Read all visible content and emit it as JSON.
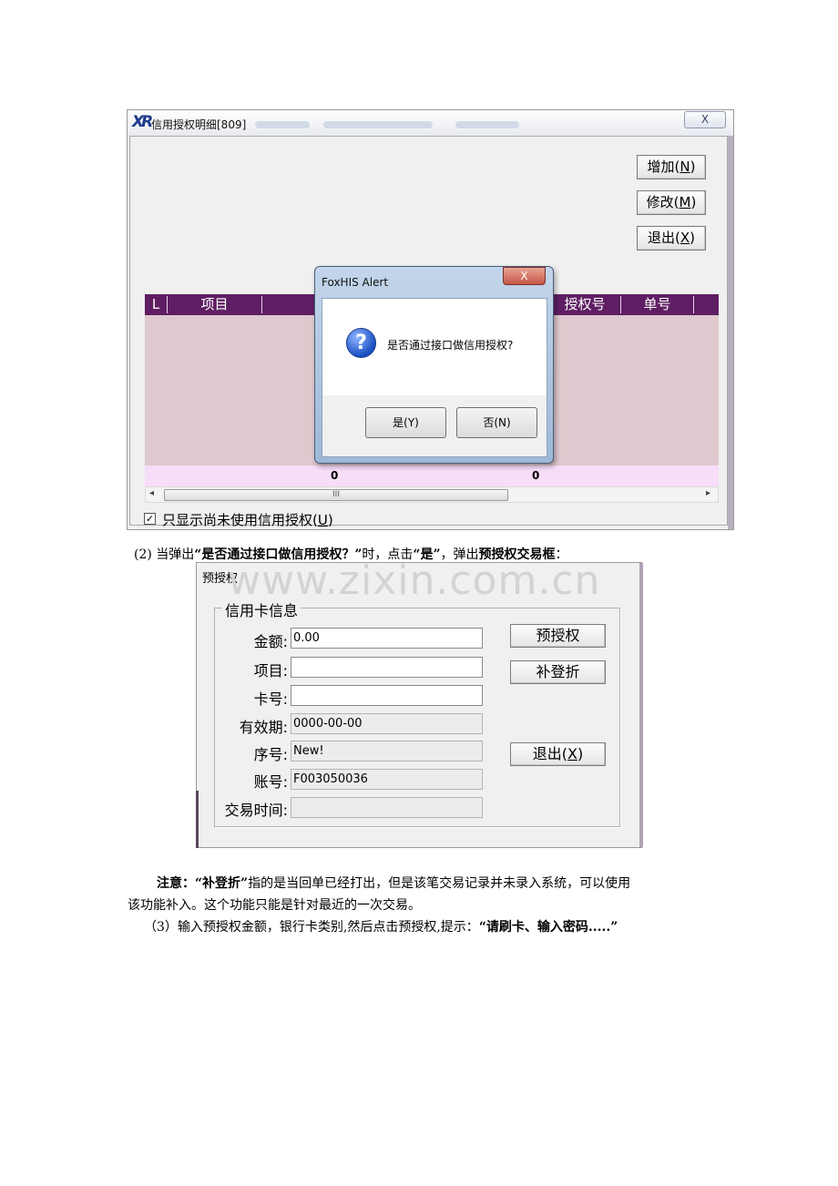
{
  "window1": {
    "title": "信用授权明细[809]",
    "close_label": "X",
    "buttons": {
      "add": "增加",
      "add_key": "N",
      "edit": "修改",
      "edit_key": "M",
      "exit": "退出",
      "exit_key": "X"
    },
    "grid": {
      "columns": [
        "L",
        "项目",
        "授权号",
        "单号"
      ],
      "footer_values": [
        "0",
        "0"
      ]
    },
    "scrollbar_thumb": "III",
    "checkbox": {
      "checked_mark": "✓",
      "label": "只显示尚未使用信用授权",
      "key": "U"
    }
  },
  "alert": {
    "title": "FoxHIS Alert",
    "close_label": "X",
    "message": "是否通过接口做信用授权?",
    "yes_label": "是(Y)",
    "no_label": "否(N)"
  },
  "paragraph2": {
    "num": "(2) 当弹出",
    "bold1": "“是否通过接口做信用授权？”",
    "mid": "时，点击",
    "bold2": "“是”",
    "mid2": "，弹出",
    "bold3": "预授权交易框",
    "tail": "："
  },
  "window2": {
    "title": "预授权",
    "watermark": "www.zixin.com.cn",
    "group_title": "信用卡信息",
    "fields": [
      {
        "label": "金额:",
        "value": "0.00"
      },
      {
        "label": "项目:",
        "value": ""
      },
      {
        "label": "卡号:",
        "value": ""
      },
      {
        "label": "有效期:",
        "value": "0000-00-00"
      },
      {
        "label": "序号:",
        "value": "New!"
      },
      {
        "label": "账号:",
        "value": "F003050036"
      },
      {
        "label": "交易时间:",
        "value": ""
      }
    ],
    "buttons": {
      "preauth": "预授权",
      "supplement": "补登折",
      "exit": "退出",
      "exit_key": "X"
    }
  },
  "note": {
    "bold_prefix": "注意：“补登折”",
    "line1_rest": "指的是当回单已经打出，但是该笔交易记录并未录入系统，可以使用",
    "line2": "该功能补入。这个功能只能是针对最近的一次交易。"
  },
  "paragraph3": {
    "text": "（3）输入预授权金额，银行卡类别,然后点击预授权,提示：",
    "bold": "“请刷卡、输入密码.....”"
  }
}
